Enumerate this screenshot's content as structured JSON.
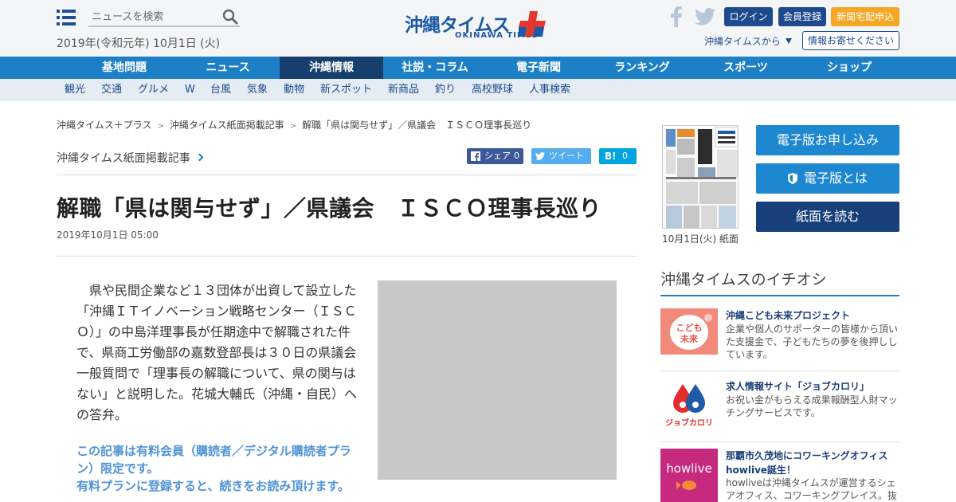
{
  "header": {
    "search_placeholder": "ニュースを検索",
    "date": "2019年(令和元年) 10月1日 (火)",
    "logo_main": "沖縄タイムス",
    "logo_sub": "OKINAWA TIMES",
    "logo_plus": "プラス",
    "login": "ログイン",
    "register": "会員登録",
    "delivery": "新聞宅配申込",
    "from_link": "沖縄タイムスから",
    "tip_button": "情報お寄せください"
  },
  "nav": {
    "items": [
      "基地問題",
      "ニュース",
      "沖縄情報",
      "社説・コラム",
      "電子新聞",
      "ランキング",
      "スポーツ",
      "ショップ"
    ],
    "active": "沖縄情報"
  },
  "subnav": {
    "items": [
      "観光",
      "交通",
      "グルメ",
      "W",
      "台風",
      "気象",
      "動物",
      "新スポット",
      "新商品",
      "釣り",
      "高校野球",
      "人事検索"
    ]
  },
  "breadcrumb": [
    "沖縄タイムス＋プラス",
    "沖縄タイムス紙面掲載記事",
    "解職「県は関与せず」／県議会　ＩＳＣＯ理事長巡り"
  ],
  "article": {
    "section": "沖縄タイムス紙面掲載記事",
    "share": {
      "fb_label": "シェア",
      "fb_count": "0",
      "tw_label": "ツイート",
      "hb_label": "B!",
      "hb_count": "0"
    },
    "headline": "解職「県は関与せず」／県議会　ＩＳＣＯ理事長巡り",
    "date": "2019年10月1日 05:00",
    "body": "県や民間企業など１３団体が出資して設立した「沖縄ＩＴイノベーション戦略センター（ＩＳＣＯ）」の中島洋理事長が任期途中で解職された件で、県商工労働部の嘉数登部長は３０日の県議会一般質問で「理事長の解職について、県の関与はない」と説明した。花城大輔氏（沖縄・自民）への答弁。",
    "paywall_1": "この記事は有料会員（購読者／デジタル購読者プラン）限定です。",
    "paywall_2": "有料プランに登録すると、続きをお読み頂けます。"
  },
  "sidebar": {
    "thumb_caption": "10月1日(火) 紙面",
    "btn_subscribe": "電子版お申し込み",
    "btn_about": "電子版とは",
    "btn_read": "紙面を読む",
    "picks_title": "沖縄タイムスのイチオシ",
    "picks": [
      {
        "title": "沖縄こども未来プロジェクト",
        "desc": "企業や個人のサポーターの皆様から頂いた支援金で、子どもたちの夢を後押ししています。",
        "img_text_1": "こども",
        "img_text_2": "未来"
      },
      {
        "title": "求人情報サイト「ジョブカロリ」",
        "desc": "お祝い金がもらえる成果報酬型人財マッチングサービスです。",
        "img_text_1": "ジョブカロリ"
      },
      {
        "title": "那覇市久茂地にコワーキングオフィスhowlive誕生！",
        "desc": "howliveは沖縄タイムスが運営するシェアオフィス、コワーキングプレイス。抜",
        "img_text_1": "howlive"
      }
    ]
  },
  "colors": {
    "nav_blue": "#1d7fc5",
    "nav_active": "#173f6e",
    "brand_navy": "#1c4a8c",
    "delivery_orange": "#f5a623",
    "paywall_blue": "#4f93d6",
    "facebook": "#3b5998",
    "twitter": "#55acee",
    "hatena": "#00a4de"
  },
  "icons": [
    "menu-icon",
    "search-icon",
    "facebook-icon",
    "twitter-icon",
    "dropdown-triangle-icon",
    "chevron-right-icon",
    "shield-icon"
  ]
}
